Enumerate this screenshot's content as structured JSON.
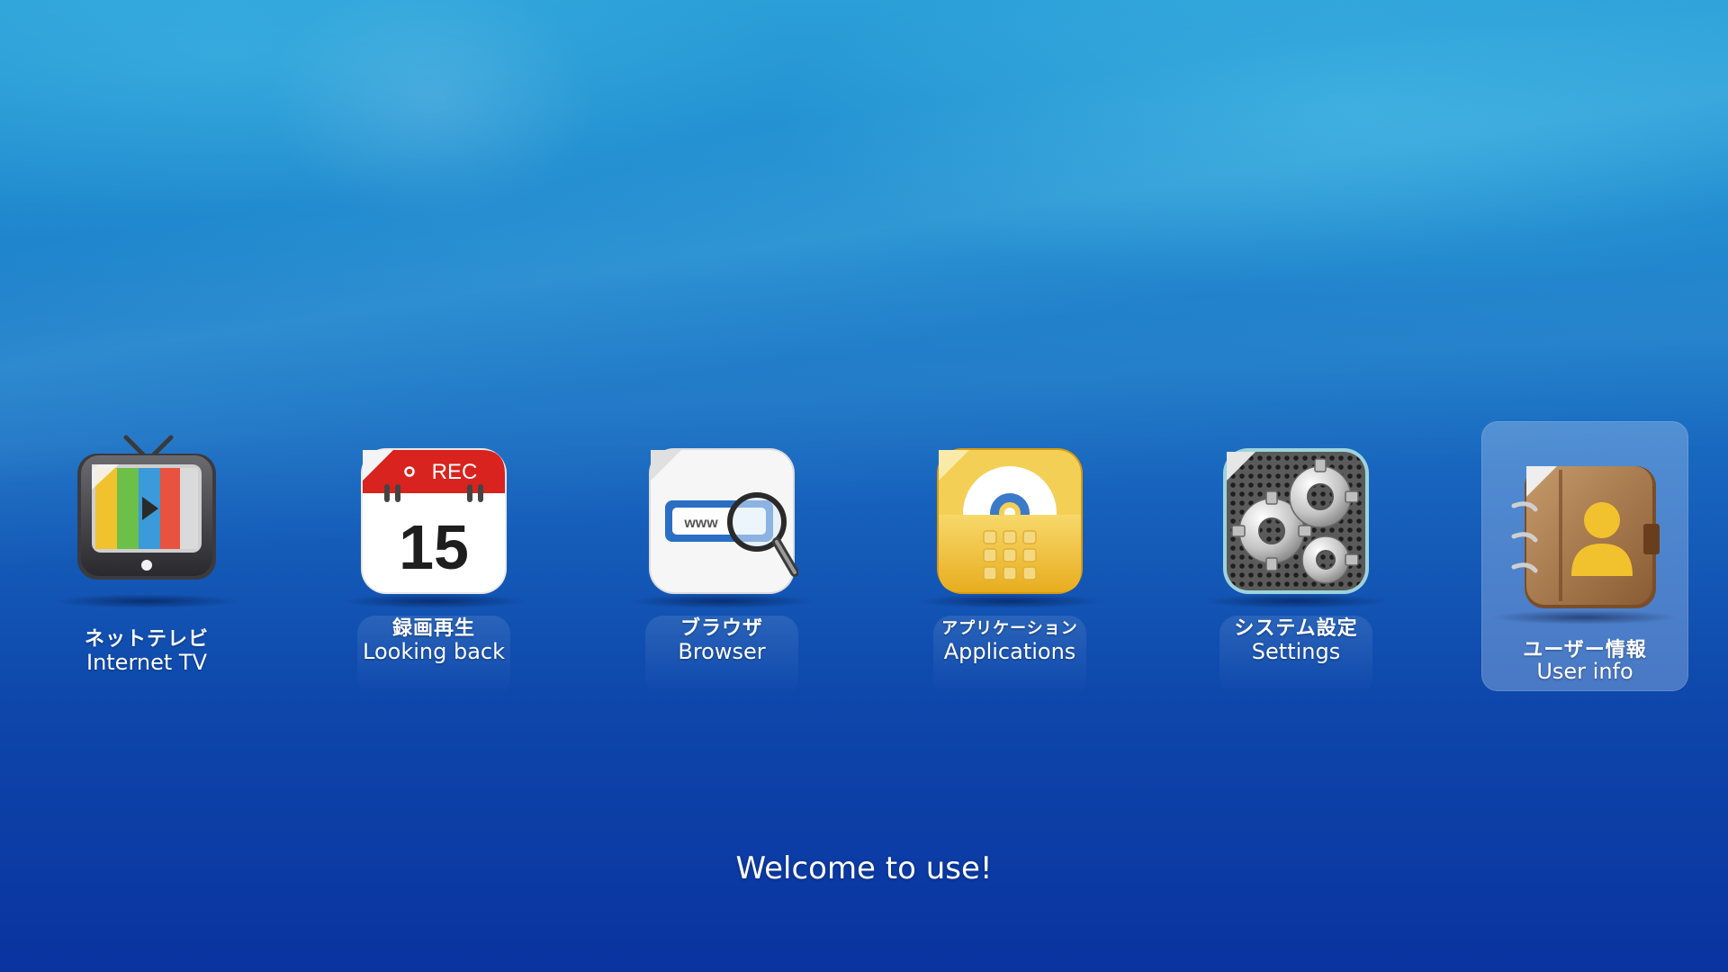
{
  "launcher": {
    "items": [
      {
        "label_jp": "ネットテレビ",
        "label_en": "Internet TV",
        "icon": "tv-icon",
        "selected": false
      },
      {
        "label_jp": "録画再生",
        "label_en": "Looking back",
        "icon": "calendar-rec-icon",
        "selected": false,
        "icon_text": {
          "rec": "REC",
          "day": "15"
        }
      },
      {
        "label_jp": "ブラウザ",
        "label_en": "Browser",
        "icon": "browser-magnifier-icon",
        "selected": false,
        "icon_text": {
          "www": "www"
        }
      },
      {
        "label_jp": "アプリケーション",
        "label_en": "Applications",
        "icon": "applications-folder-icon",
        "selected": false
      },
      {
        "label_jp": "システム設定",
        "label_en": "Settings",
        "icon": "gears-icon",
        "selected": false
      },
      {
        "label_jp": "ユーザー情報",
        "label_en": "User info",
        "icon": "address-book-icon",
        "selected": true
      }
    ]
  },
  "welcome": {
    "text": "Welcome to use!"
  },
  "colors": {
    "background_top": "#2a9fd8",
    "background_bottom": "#0a33a0",
    "selected_tile": "#aac8f0",
    "rec_red": "#d8231e",
    "folder_yellow": "#f1c33c",
    "book_brown": "#a7784a"
  }
}
